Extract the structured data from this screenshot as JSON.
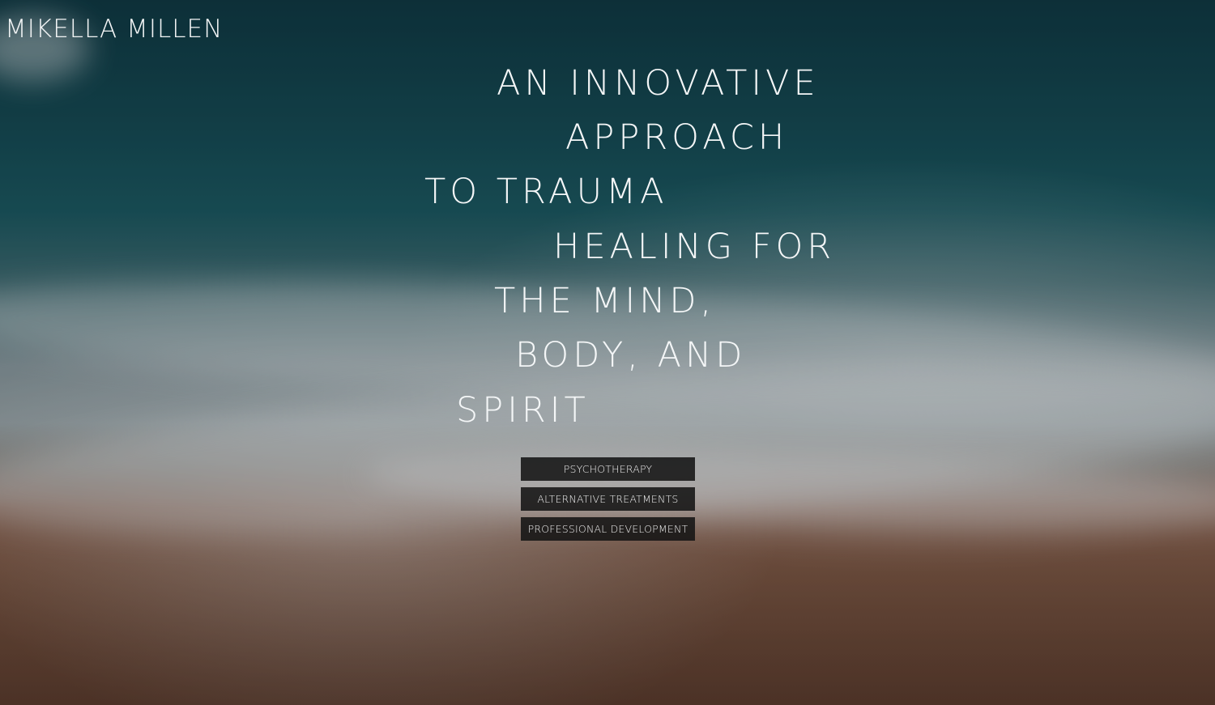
{
  "brand": {
    "name": "MIKELLA MILLEN"
  },
  "headline": {
    "lines": [
      "AN INNOVATIVE",
      "APPROACH",
      "TO TRAUMA",
      "HEALING FOR",
      "THE MIND,",
      "BODY, AND",
      "SPIRIT"
    ]
  },
  "nav": {
    "items": [
      {
        "label": "PSYCHOTHERAPY"
      },
      {
        "label": "ALTERNATIVE TREATMENTS"
      },
      {
        "label": "PROFESSIONAL DEVELOPMENT"
      }
    ]
  },
  "background": {
    "description_icon": "ocean-beach-aerial-image",
    "colors": {
      "ocean_deep": "#103a45",
      "ocean_mid": "#1c5a63",
      "foam": "#dfe6e9",
      "sand": "#7f5a47"
    }
  },
  "colors": {
    "text": "#f4f6f7",
    "button_bg": "#141414",
    "button_text": "#f0f0f0"
  }
}
